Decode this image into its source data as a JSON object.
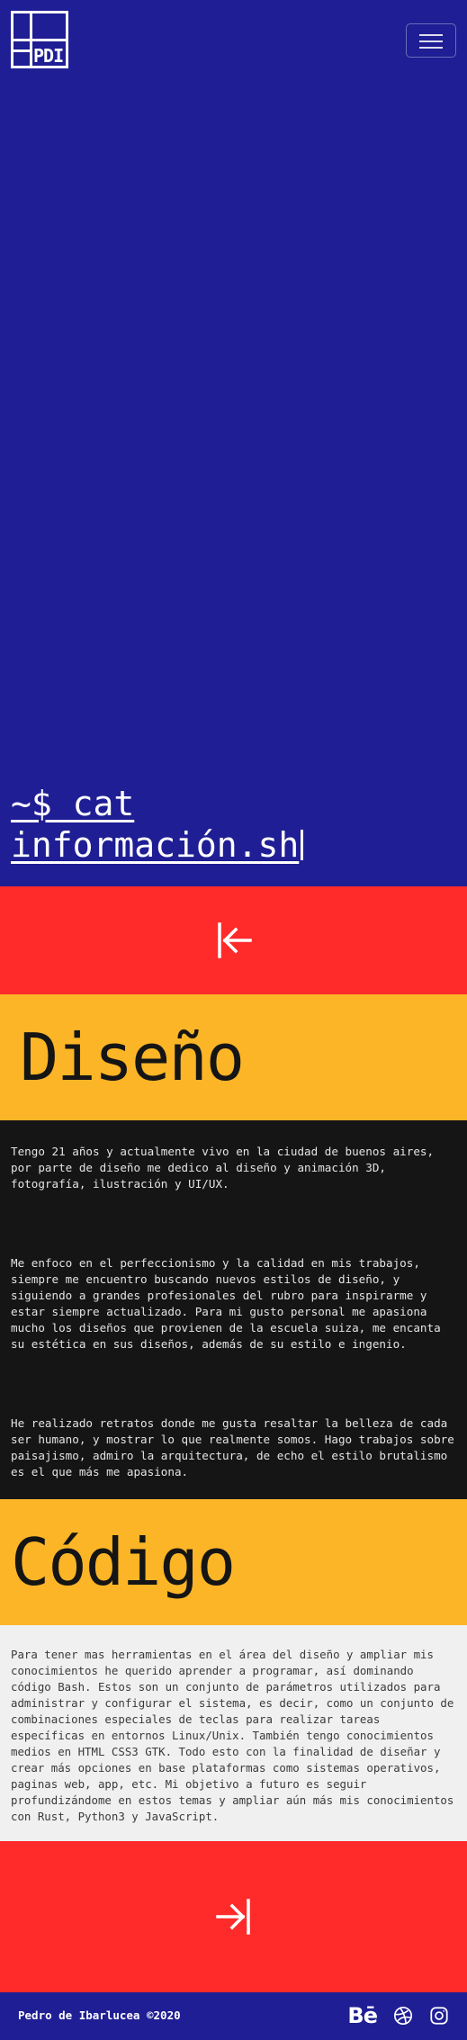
{
  "header": {
    "logo_text": "PDI",
    "menu_icon": "hamburger-menu-icon"
  },
  "hero": {
    "command": "~$ cat\ninformación.sh"
  },
  "nav": {
    "top_arrow_icon": "arrow-left-to-bar-icon",
    "bottom_arrow_icon": "arrow-right-to-bar-icon"
  },
  "design": {
    "heading": "Diseño",
    "paragraphs": [
      "Tengo 21 años y actualmente vivo en la ciudad de buenos aires, por parte de diseño me dedico al diseño y animación 3D, fotografía, ilustración y UI/UX.",
      "Me enfoco en el perfeccionismo y la calidad en mis trabajos, siempre me encuentro buscando nuevos estilos de diseño, y siguiendo a grandes profesionales del rubro para inspirarme y estar siempre actualizado. Para mi gusto personal me apasiona mucho los diseños que provienen de la escuela suiza, me encanta su estética en sus diseños, además de su estilo e ingenio.",
      "He realizado retratos donde me gusta resaltar la belleza de cada ser humano, y mostrar lo que realmente somos. Hago trabajos sobre paisajismo, admiro la arquitectura, de echo el estilo brutalismo es el que más me apasiona."
    ]
  },
  "code": {
    "heading": "Código",
    "paragraph": "Para tener mas herramientas en el área del diseño y ampliar mis conocimientos he querido aprender a programar, así dominando código Bash. Estos son un conjunto de parámetros utilizados para administrar y configurar el sistema, es decir, como un conjunto de combinaciones especiales de teclas para realizar tareas específicas en entornos Linux/Unix. También tengo conocimientos medios en HTML CSS3 GTK. Todo esto con la finalidad de diseñar y crear más opciones en base plataformas como sistemas operativos, paginas web, app, etc. Mi objetivo a futuro es seguir profundizándome en estos temas y ampliar aún más mis conocimientos con Rust, Python3 y JavaScript."
  },
  "footer": {
    "copyright": "Pedro de Ibarlucea ©2020",
    "behance_label": "Bē",
    "icons": [
      "behance-icon",
      "dribbble-icon",
      "instagram-icon"
    ]
  },
  "colors": {
    "blue": "#1f1e94",
    "red": "#ff2a2a",
    "yellow": "#fbb526",
    "dark": "#151515",
    "light": "#f0f0f0"
  }
}
